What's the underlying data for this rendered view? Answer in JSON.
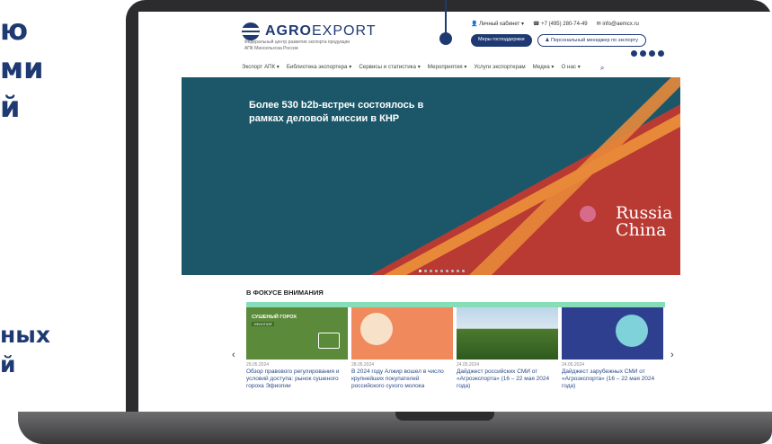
{
  "side_text": {
    "top": [
      "ю",
      "ми",
      "й"
    ],
    "bottom": [
      "ных",
      "й"
    ]
  },
  "header": {
    "logo_bold": "AGRO",
    "logo_light": "EXPORT",
    "logo_subtitle": "Федеральный центр развития экспорта продукции АПК Минсельхоза России",
    "top_links": [
      "Личный кабинет",
      "+7 (495) 280-74-49",
      "info@aemcx.ru"
    ],
    "btn_support": "Меры господдержки",
    "btn_manager": "Персональный менеджер по экспорту"
  },
  "nav": {
    "items": [
      "Экспорт АПК",
      "Библиотека экспортера",
      "Сервисы и статистика",
      "Мероприятия",
      "Услуги экспортерам",
      "Медиа",
      "О нас"
    ],
    "search_icon": "search-icon"
  },
  "hero": {
    "title": "Более 530 b2b-встреч состоялось в рамках деловой миссии в КНР",
    "badge_line1": "Russia",
    "badge_line2": "China",
    "slides": 9,
    "active_slide": 1,
    "colors": {
      "bg": "#1b5769",
      "red": "#b83a33",
      "orange": "#e8893a"
    }
  },
  "focus": {
    "title": "В ФОКУСЕ ВНИМАНИЯ",
    "cards": [
      {
        "date": "29.05.2024",
        "title": "Обзор правового регулирования и условий доступа: рынок сушеного гороха Эфиопии",
        "img_text": "СУШЕНЫЙ ГОРОХ",
        "img_sub": "ЭФИОПИЯ"
      },
      {
        "date": "28.05.2024",
        "title": "В 2024 году Алжир вошел в число крупнейших покупателей российского сухого молока"
      },
      {
        "date": "24.05.2024",
        "title": "Дайджест российских СМИ от «Агроэкспорта» (16 – 22 мая 2024 года)"
      },
      {
        "date": "24.05.2024",
        "title": "Дайджест зарубежных СМИ от «Агроэкспорта» (16 – 22 мая 2024 года)"
      }
    ],
    "prev": "‹",
    "next": "›"
  }
}
